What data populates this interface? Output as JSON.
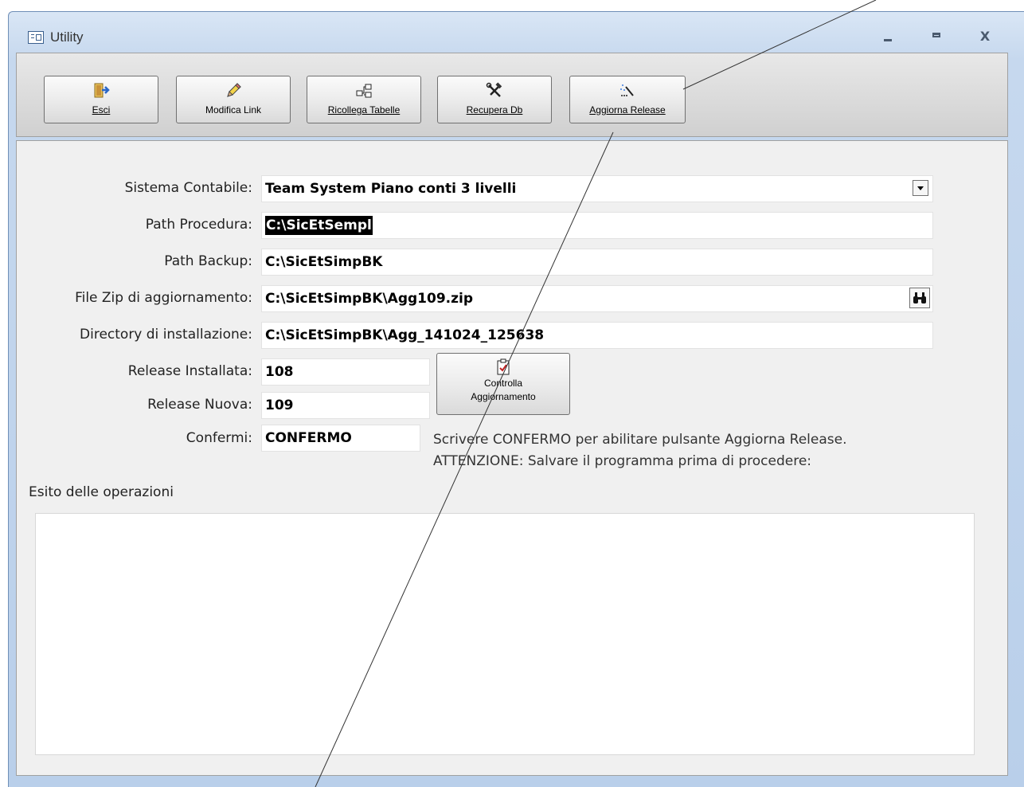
{
  "window": {
    "title": "Utility",
    "controls": [
      "minimize",
      "maximize",
      "close"
    ]
  },
  "toolbar": {
    "buttons": [
      {
        "label": "Esci",
        "icon": "exit-door-icon"
      },
      {
        "label": "Modifica Link",
        "icon": "pencil-icon"
      },
      {
        "label": "Ricollega Tabelle",
        "icon": "relink-tables-icon"
      },
      {
        "label": "Recupera Db",
        "icon": "tools-hammer-icon"
      },
      {
        "label": "Aggiorna Release",
        "icon": "magic-wand-icon"
      }
    ]
  },
  "form": {
    "sistema_contabile": {
      "label": "Sistema Contabile:",
      "value": "Team System Piano conti 3 livelli"
    },
    "path_procedura": {
      "label": "Path Procedura:",
      "value": "C:\\SicEtSempl"
    },
    "path_backup": {
      "label": "Path Backup:",
      "value": "C:\\SicEtSimpBK"
    },
    "file_zip": {
      "label": "File Zip di aggiornamento:",
      "value": "C:\\SicEtSimpBK\\Agg109.zip"
    },
    "directory": {
      "label": "Directory di installazione:",
      "value": "C:\\SicEtSimpBK\\Agg_141024_125638"
    },
    "release_installata": {
      "label": "Release Installata:",
      "value": "108"
    },
    "release_nuova": {
      "label": "Release Nuova:",
      "value": "109"
    },
    "confermi": {
      "label": "Confermi:",
      "value": "CONFERMO"
    },
    "check_button": {
      "line1": "Controlla",
      "line2": "Aggiornamento",
      "icon": "clipboard-check-icon"
    },
    "info_line1": "Scrivere CONFERMO per abilitare pulsante Aggiorna Release.",
    "info_line2": "ATTENZIONE: Salvare il programma prima di procedere:",
    "esito_label": "Esito delle operazioni",
    "esito_value": ""
  }
}
